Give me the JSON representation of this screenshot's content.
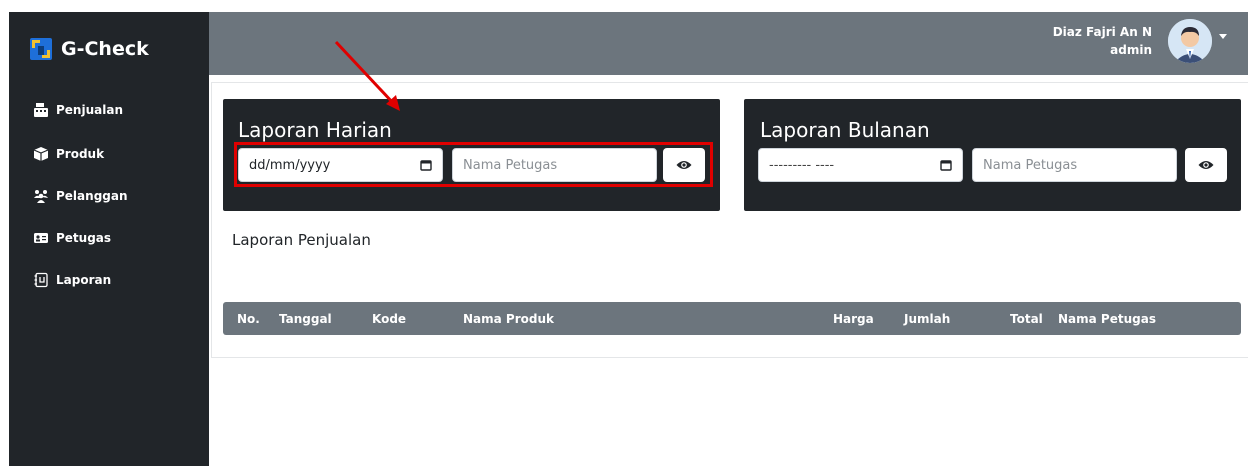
{
  "brand": {
    "name": "G-Check",
    "icon": "brand-logo-icon"
  },
  "sidebar": {
    "items": [
      {
        "label": "Penjualan",
        "icon": "cash-register-icon"
      },
      {
        "label": "Produk",
        "icon": "box-icon"
      },
      {
        "label": "Pelanggan",
        "icon": "users-icon"
      },
      {
        "label": "Petugas",
        "icon": "id-card-icon"
      },
      {
        "label": "Laporan",
        "icon": "book-icon"
      }
    ]
  },
  "topbar": {
    "user_name": "Diaz Fajri An N",
    "user_role": "admin",
    "avatar_icon": "user-avatar",
    "dropdown_icon": "caret-down-icon"
  },
  "daily_report": {
    "title": "Laporan Harian",
    "date_value": "dd/mm/yyyy",
    "officer_placeholder": "Nama Petugas",
    "view_icon": "eye-icon"
  },
  "monthly_report": {
    "title": "Laporan Bulanan",
    "month_value": "--------- ----",
    "officer_placeholder": "Nama Petugas",
    "view_icon": "eye-icon"
  },
  "sales_report": {
    "title": "Laporan Penjualan",
    "columns": [
      "No.",
      "Tanggal",
      "Kode",
      "Nama Produk",
      "Harga",
      "Jumlah",
      "Total",
      "Nama Petugas"
    ]
  },
  "colors": {
    "sidebar": "#212529",
    "topbar": "#6c757d",
    "card": "#212529",
    "highlight": "#e00000",
    "arrow": "#e00000"
  }
}
